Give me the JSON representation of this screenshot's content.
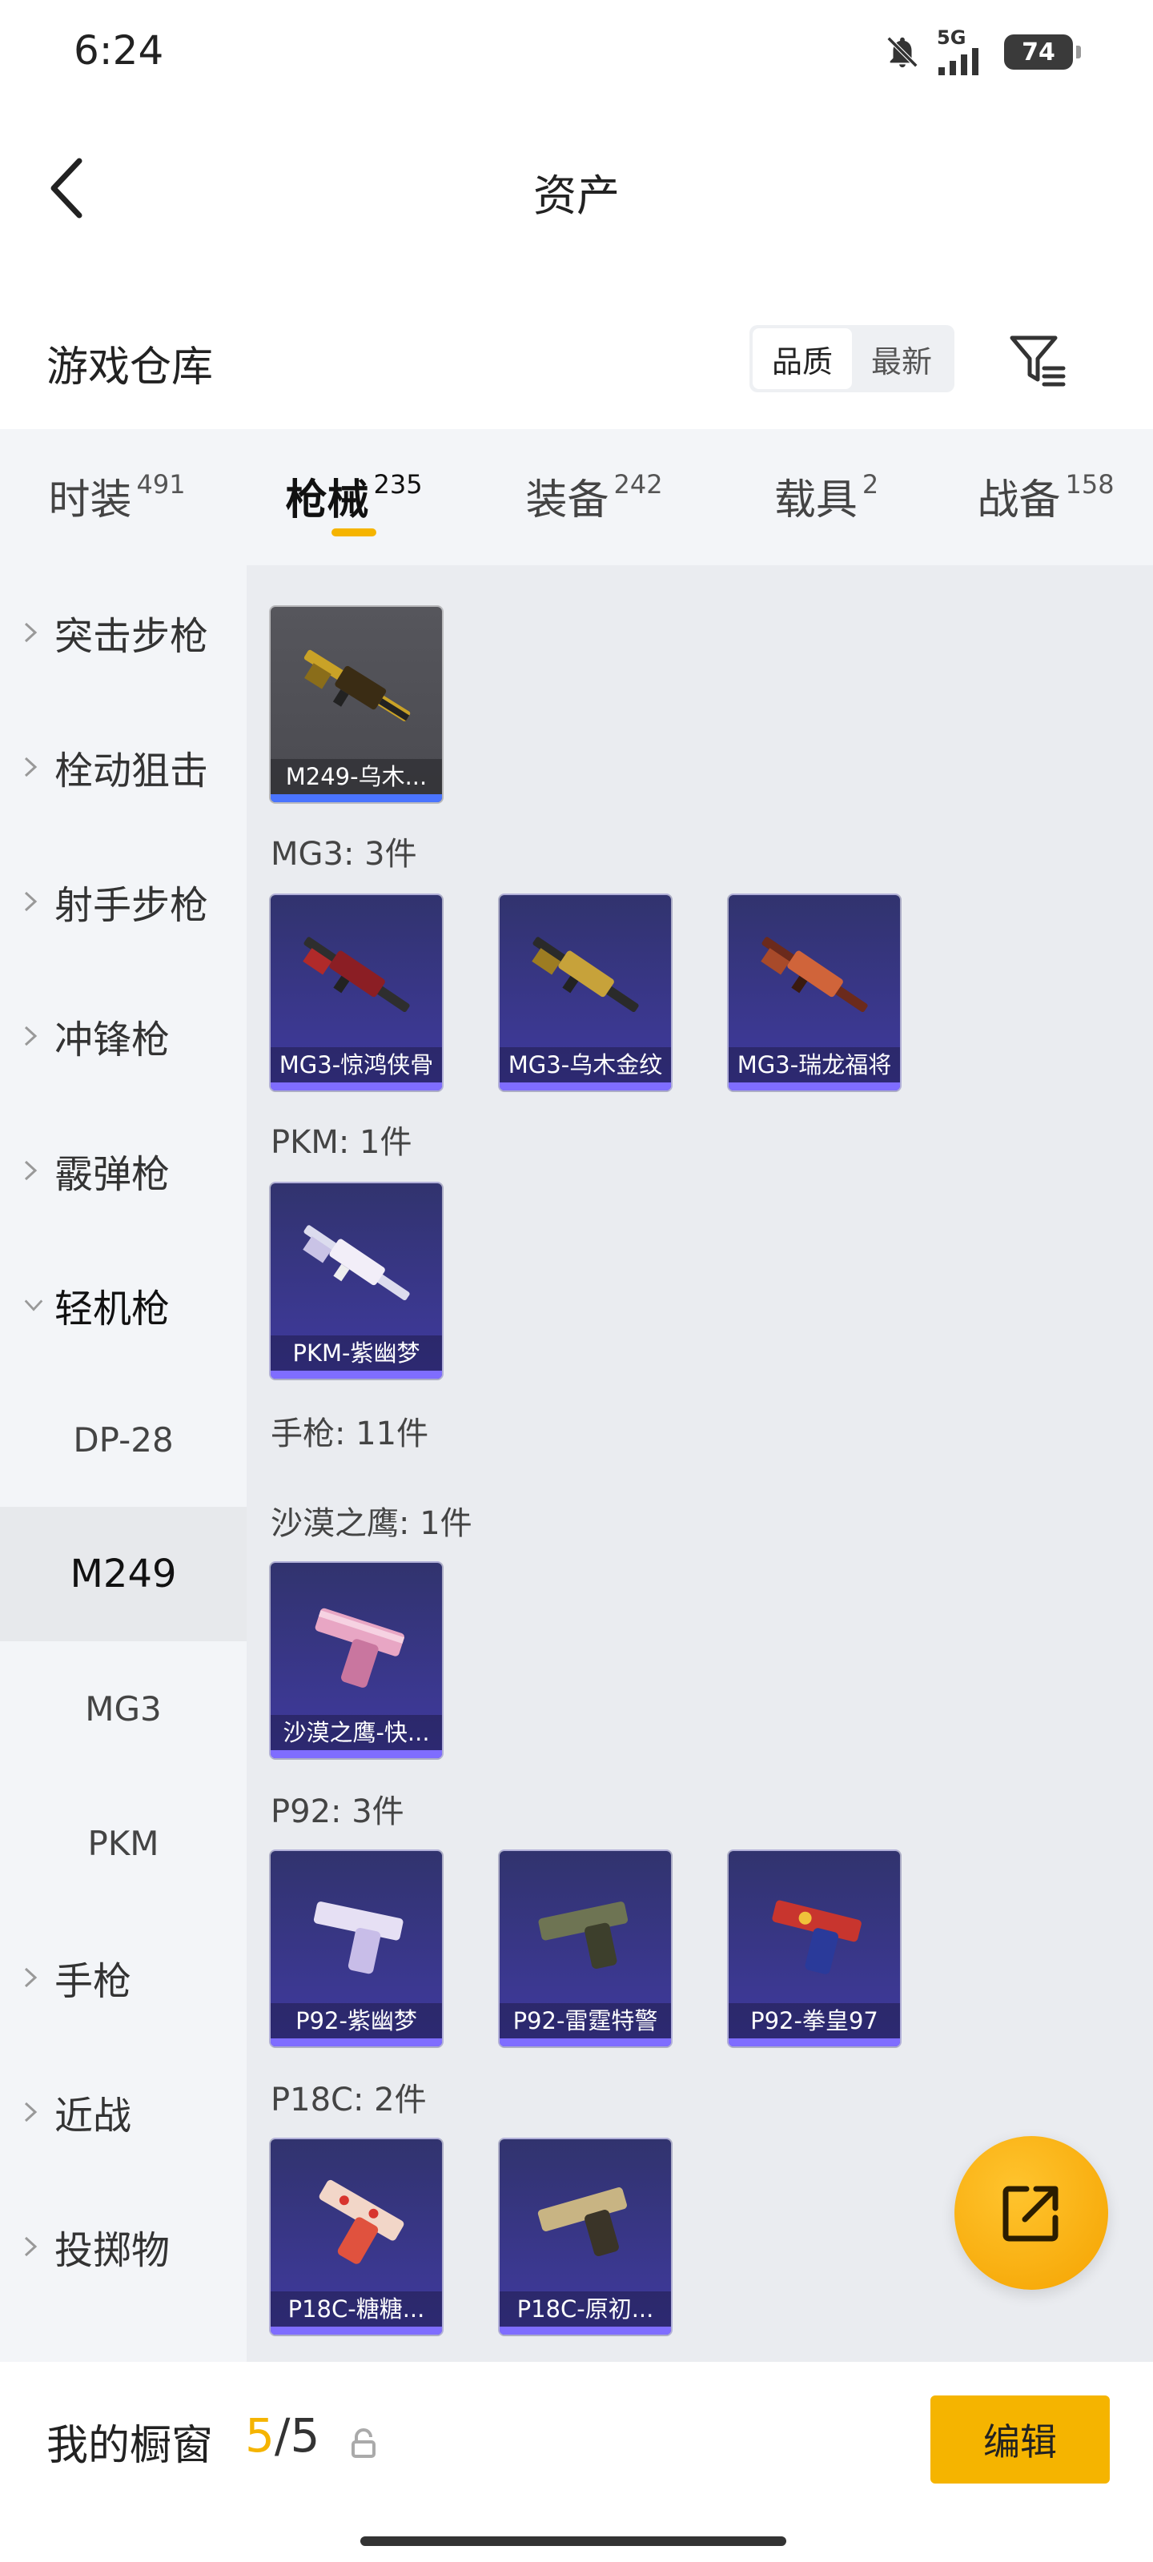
{
  "status": {
    "time": "6:24",
    "network": "5G",
    "battery": "74"
  },
  "header": {
    "title": "资产"
  },
  "section": {
    "title": "游戏仓库",
    "sort_options": [
      "品质",
      "最新"
    ],
    "active_sort": "品质"
  },
  "tabs": [
    {
      "label": "时装",
      "count": "491"
    },
    {
      "label": "枪械",
      "count": "235",
      "active": true
    },
    {
      "label": "装备",
      "count": "242"
    },
    {
      "label": "载具",
      "count": "2"
    },
    {
      "label": "战备",
      "count": "158"
    }
  ],
  "sidebar": {
    "items": [
      {
        "label": "突击步枪"
      },
      {
        "label": "栓动狙击"
      },
      {
        "label": "射手步枪"
      },
      {
        "label": "冲锋枪"
      },
      {
        "label": "霰弹枪"
      },
      {
        "label": "轻机枪",
        "expanded": true
      },
      {
        "label": "手枪"
      },
      {
        "label": "近战"
      },
      {
        "label": "投掷物"
      }
    ],
    "sub_items": [
      {
        "label": "DP-28"
      },
      {
        "label": "M249",
        "active": true
      },
      {
        "label": "MG3"
      },
      {
        "label": "PKM"
      }
    ]
  },
  "content": {
    "groups": [
      {
        "label": "",
        "items": [
          {
            "name": "M249-乌木...",
            "style": "gray",
            "icon": "machine-gun-gold-icon"
          }
        ]
      },
      {
        "label": "MG3: 3件",
        "items": [
          {
            "name": "MG3-惊鸿侠骨",
            "style": "purple",
            "icon": "machine-gun-red-icon"
          },
          {
            "name": "MG3-乌木金纹",
            "style": "purple",
            "icon": "machine-gun-gold-icon"
          },
          {
            "name": "MG3-瑞龙福将",
            "style": "purple",
            "icon": "machine-gun-red-icon"
          }
        ]
      },
      {
        "label": "PKM: 1件",
        "items": [
          {
            "name": "PKM-紫幽梦",
            "style": "purple",
            "icon": "machine-gun-silver-icon"
          }
        ]
      },
      {
        "label": "手枪: 11件",
        "items": []
      },
      {
        "label": "沙漠之鹰: 1件",
        "items": [
          {
            "name": "沙漠之鹰-快...",
            "style": "purple",
            "icon": "pistol-pink-icon"
          }
        ]
      },
      {
        "label": "P92: 3件",
        "items": [
          {
            "name": "P92-紫幽梦",
            "style": "purple",
            "icon": "pistol-silver-icon"
          },
          {
            "name": "P92-雷霆特警",
            "style": "purple",
            "icon": "pistol-camo-icon"
          },
          {
            "name": "P92-拳皇97",
            "style": "purple",
            "icon": "pistol-blue-icon"
          }
        ]
      },
      {
        "label": "P18C: 2件",
        "items": [
          {
            "name": "P18C-糖糖...",
            "style": "purple",
            "icon": "pistol-red-icon"
          },
          {
            "name": "P18C-原初...",
            "style": "purple",
            "icon": "pistol-gold-icon"
          }
        ]
      }
    ]
  },
  "bottom": {
    "title": "我的橱窗",
    "current": "5",
    "separator": "/",
    "max": "5",
    "edit_label": "编辑"
  },
  "colors": {
    "accent": "#f5b400",
    "card_purple": "#3a3790",
    "card_gray": "#525258"
  }
}
